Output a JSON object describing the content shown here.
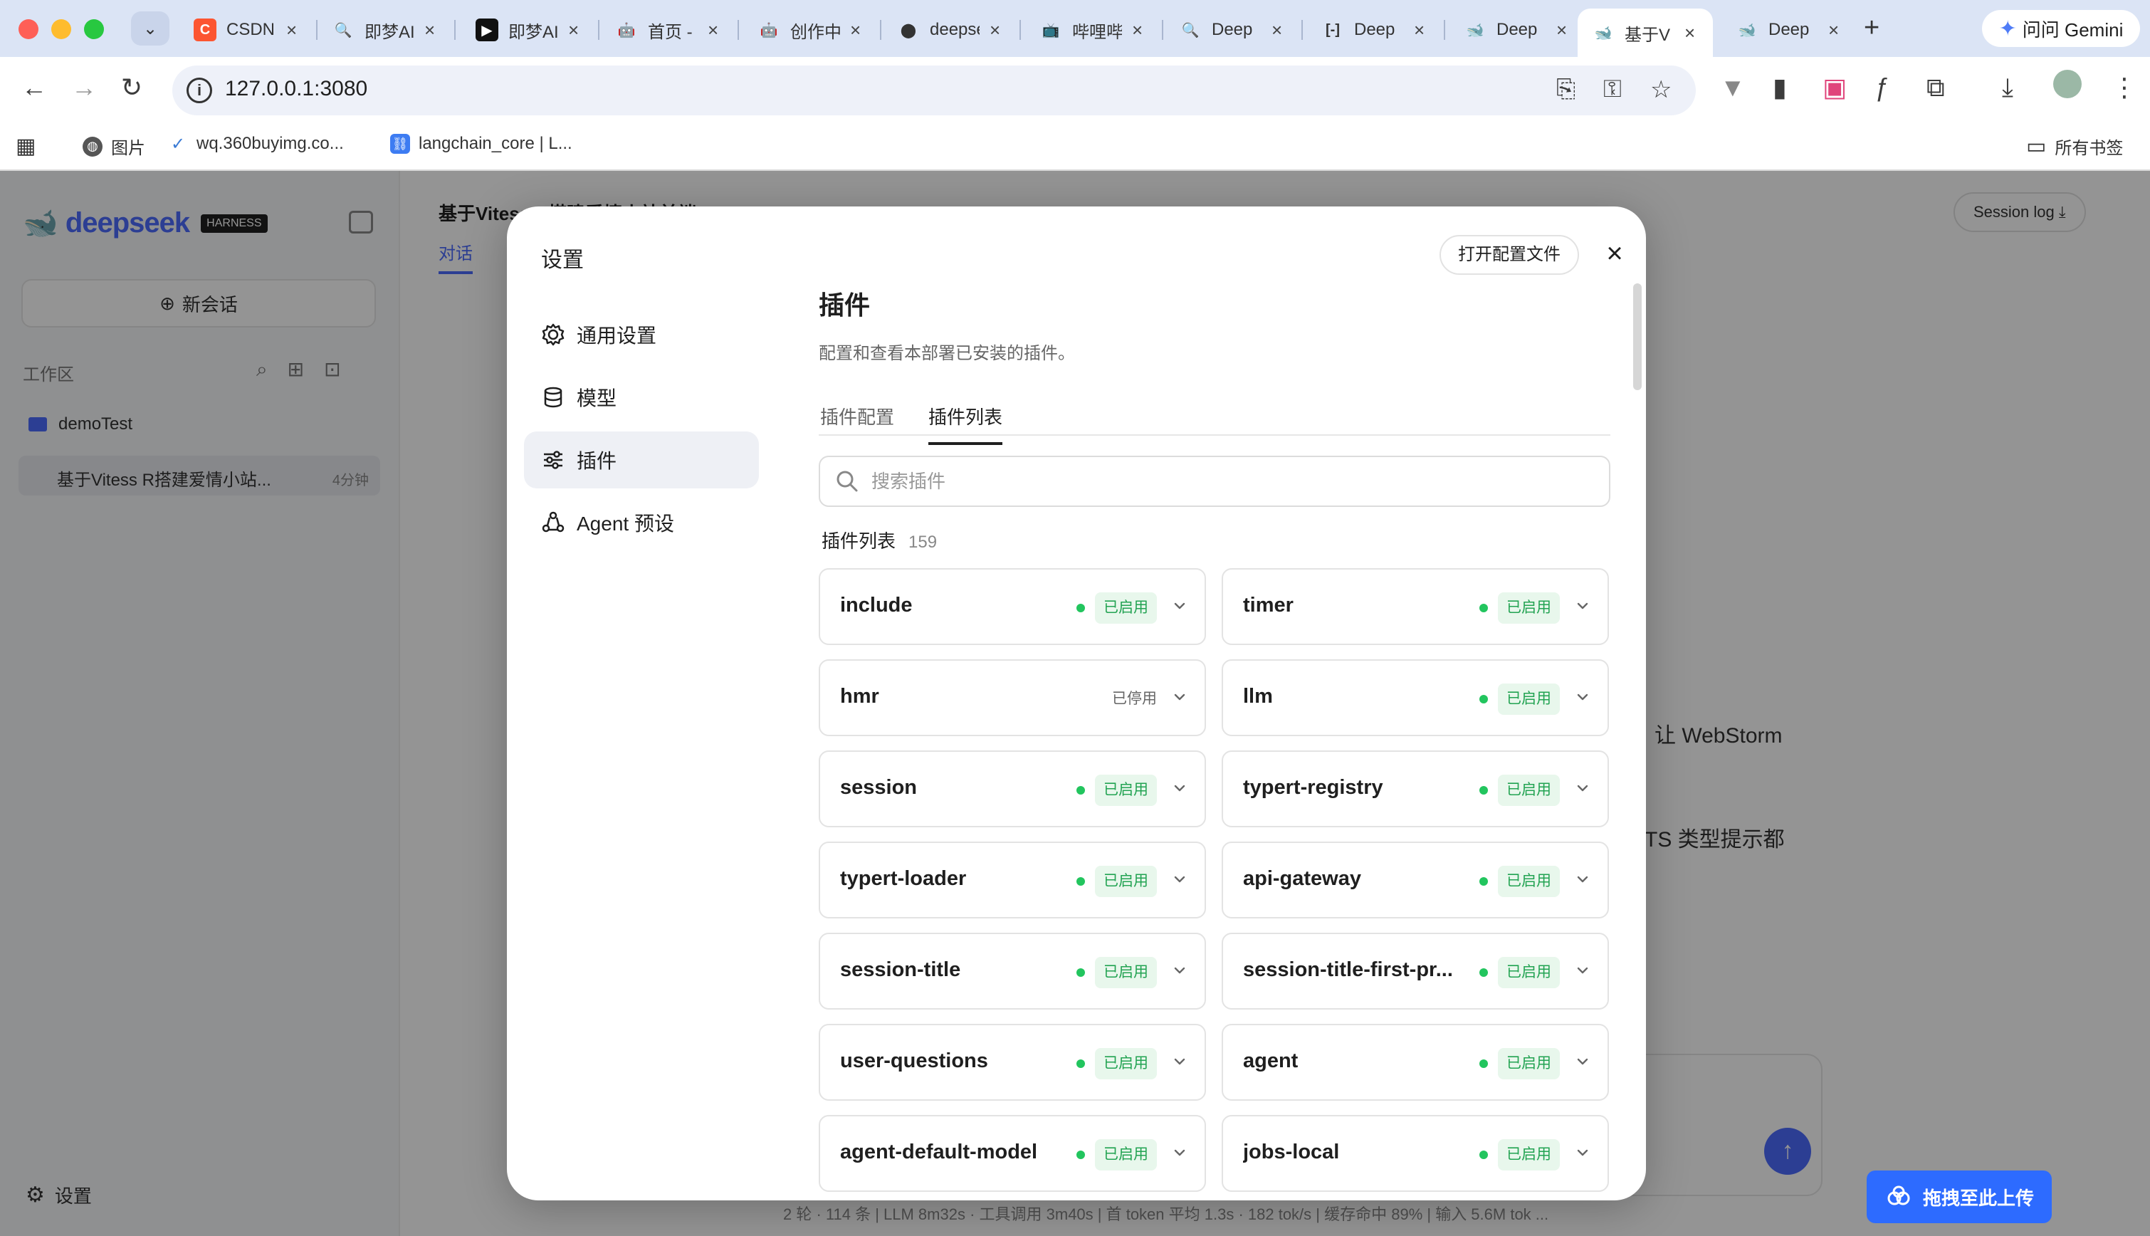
{
  "browser": {
    "tabs": [
      {
        "title": "CSDN",
        "favicon_text": "C",
        "favicon_color": "#fc5531"
      },
      {
        "title": "即梦AI",
        "favicon_text": "🔍",
        "favicon_color": "#dbe4f5"
      },
      {
        "title": "即梦AI",
        "favicon_text": "▶",
        "favicon_color": "#111111"
      },
      {
        "title": "首页 - ",
        "favicon_text": "🤖",
        "favicon_color": "#dbe4f5"
      },
      {
        "title": "创作中心",
        "favicon_text": "🤖",
        "favicon_color": "#dbe4f5"
      },
      {
        "title": "deepseek",
        "favicon_text": "⬤",
        "favicon_color": "#dbe4f5"
      },
      {
        "title": "哔哩哔哩",
        "favicon_text": "📺",
        "favicon_color": "#dbe4f5"
      },
      {
        "title": "Deep",
        "favicon_text": "🔍",
        "favicon_color": "#dbe4f5"
      },
      {
        "title": "Deep",
        "favicon_text": "[-]",
        "favicon_color": "#dbe4f5"
      },
      {
        "title": "Deep",
        "favicon_text": "🐋",
        "favicon_color": "#dbe4f5"
      },
      {
        "title": "基于V",
        "favicon_text": "🐋",
        "favicon_color": "#ffffff"
      },
      {
        "title": "Deep",
        "favicon_text": "🐋",
        "favicon_color": "#dbe4f5"
      }
    ],
    "gemini_label": "问问 Gemini",
    "url": "127.0.0.1:3080",
    "bookmarks": [
      {
        "label": "图片"
      },
      {
        "label": "wq.360buyimg.co..."
      },
      {
        "label": "langchain_core | L..."
      }
    ],
    "all_bookmarks_label": "所有书签"
  },
  "app": {
    "logo_text": "deepseek",
    "logo_badge": "HARNESS",
    "new_chat_label": "新会话",
    "workspace_label": "工作区",
    "project_name": "demoTest",
    "conversation_title": "基于Vitess R搭建爱情小站...",
    "conversation_time": "4分钟",
    "settings_label": "设置",
    "main_title": "基于Vitess R搭建爱情小站前端",
    "main_tab": "对话",
    "session_log_label": "Session log",
    "bg_line_1": "让 WebStorm",
    "bg_line_2": "TS 类型提示都",
    "bg_stats": "2 轮 · 114 条  |  LLM 8m32s · 工具调用 3m40s  |  首 token 平均 1.3s · 182 tok/s  |  缓存命中 89%  |  输入 5.6M tok ..."
  },
  "modal": {
    "title": "设置",
    "open_config_label": "打开配置文件",
    "close_icon": "×",
    "nav": [
      {
        "label": "通用设置",
        "icon": "gear-icon",
        "active": false
      },
      {
        "label": "模型",
        "icon": "database-icon",
        "active": false
      },
      {
        "label": "插件",
        "icon": "sliders-icon",
        "active": true
      },
      {
        "label": "Agent 预设",
        "icon": "agent-icon",
        "active": false
      }
    ],
    "content": {
      "title": "插件",
      "description": "配置和查看本部署已安装的插件。",
      "tabs": [
        {
          "label": "插件配置",
          "active": false
        },
        {
          "label": "插件列表",
          "active": true
        }
      ],
      "search_placeholder": "搜索插件",
      "search_value": "",
      "list_label": "插件列表",
      "list_count": "159",
      "plugins": [
        {
          "name": "include",
          "status": "已启用",
          "enabled": true
        },
        {
          "name": "timer",
          "status": "已启用",
          "enabled": true
        },
        {
          "name": "hmr",
          "status": "已停用",
          "enabled": false
        },
        {
          "name": "llm",
          "status": "已启用",
          "enabled": true
        },
        {
          "name": "session",
          "status": "已启用",
          "enabled": true
        },
        {
          "name": "typert-registry",
          "status": "已启用",
          "enabled": true
        },
        {
          "name": "typert-loader",
          "status": "已启用",
          "enabled": true
        },
        {
          "name": "api-gateway",
          "status": "已启用",
          "enabled": true
        },
        {
          "name": "session-title",
          "status": "已启用",
          "enabled": true
        },
        {
          "name": "session-title-first-pr...",
          "status": "已启用",
          "enabled": true
        },
        {
          "name": "user-questions",
          "status": "已启用",
          "enabled": true
        },
        {
          "name": "agent",
          "status": "已启用",
          "enabled": true
        },
        {
          "name": "agent-default-model",
          "status": "已启用",
          "enabled": true
        },
        {
          "name": "jobs-local",
          "status": "已启用",
          "enabled": true
        }
      ]
    }
  },
  "upload_button_label": "拖拽至此上传",
  "colors": {
    "accent": "#4d6bfe",
    "enabled_green": "#22c55e",
    "enabled_badge_bg": "#e8f7ec",
    "upload_blue": "#2d6bff"
  }
}
